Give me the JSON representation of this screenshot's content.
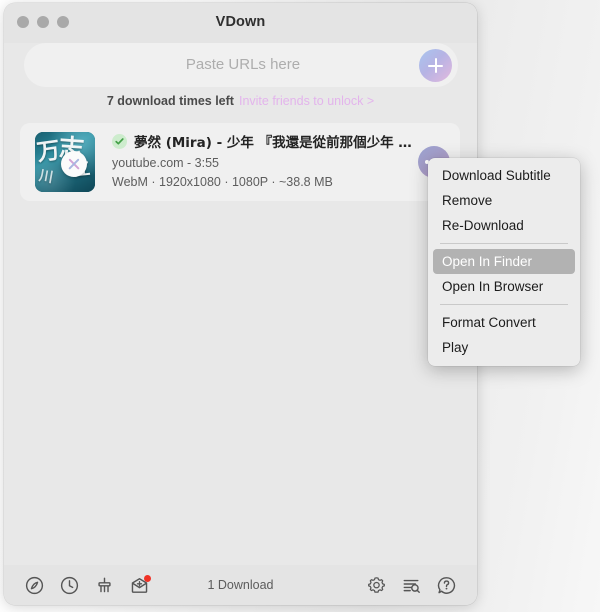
{
  "window": {
    "title": "VDown",
    "traffic_lights": [
      "close",
      "minimize",
      "zoom"
    ]
  },
  "url_bar": {
    "placeholder": "Paste URLs here",
    "value": "",
    "add_button_icon": "plus-icon"
  },
  "quota": {
    "text": "7 download times left",
    "link": "Invite friends to unlock >",
    "link_color": "#e3b4ec"
  },
  "download_item": {
    "status_icon": "check-circle-icon",
    "title": "夢然 (Mira) - 少年 『我還是從前那個少年 沒…",
    "source": "youtube.com - 3:55",
    "meta": "WebM · 1920x1080 · 1080P · ~38.8 MB",
    "cancel_icon": "close-icon",
    "more_icon": "more-dots-icon",
    "thumbnail_glyphs": [
      "万",
      "志",
      "江",
      "川"
    ]
  },
  "context_menu": {
    "groups": [
      {
        "items": [
          {
            "label": "Download Subtitle",
            "selected": false
          },
          {
            "label": "Remove",
            "selected": false
          },
          {
            "label": "Re-Download",
            "selected": false
          }
        ]
      },
      {
        "items": [
          {
            "label": "Open In Finder",
            "selected": true
          },
          {
            "label": "Open In Browser",
            "selected": false
          }
        ]
      },
      {
        "items": [
          {
            "label": "Format Convert",
            "selected": false
          },
          {
            "label": "Play",
            "selected": false
          }
        ]
      }
    ]
  },
  "bottom_bar": {
    "status": "1 Download",
    "left_icons": [
      {
        "name": "compass-icon"
      },
      {
        "name": "clock-icon"
      },
      {
        "name": "broom-icon"
      },
      {
        "name": "inbox-icon",
        "badge": true
      }
    ],
    "right_icons": [
      {
        "name": "gear-icon"
      },
      {
        "name": "list-search-icon"
      },
      {
        "name": "help-icon"
      }
    ]
  }
}
